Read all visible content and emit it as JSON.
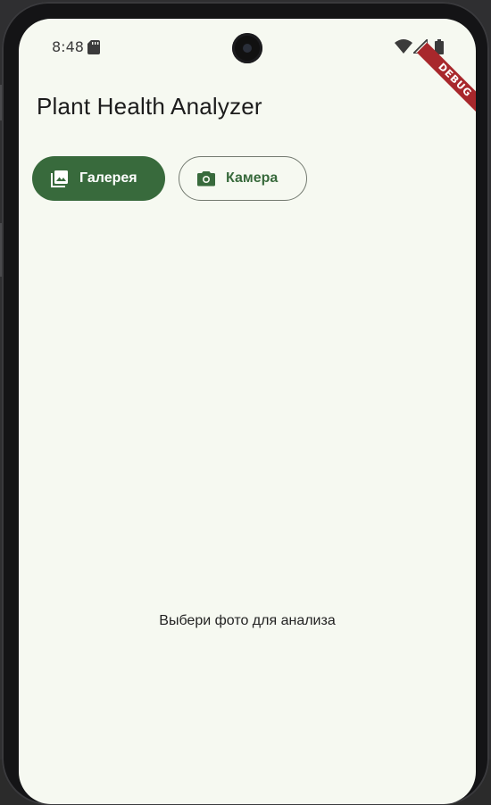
{
  "status_bar": {
    "time": "8:48",
    "icons": [
      "sd-card-icon",
      "wifi-icon",
      "cell-signal-icon",
      "battery-icon"
    ]
  },
  "debug_banner": "DEBUG",
  "app_bar": {
    "title": "Plant Health Analyzer"
  },
  "actions": {
    "gallery": {
      "label": "Галерея",
      "icon": "image-gallery-icon"
    },
    "camera": {
      "label": "Камера",
      "icon": "camera-icon"
    }
  },
  "content": {
    "placeholder": "Выбери фото для анализа"
  },
  "colors": {
    "primary": "#386a3c",
    "background": "#f6f9f1",
    "outline": "#737a70",
    "debug": "#a8282c"
  }
}
